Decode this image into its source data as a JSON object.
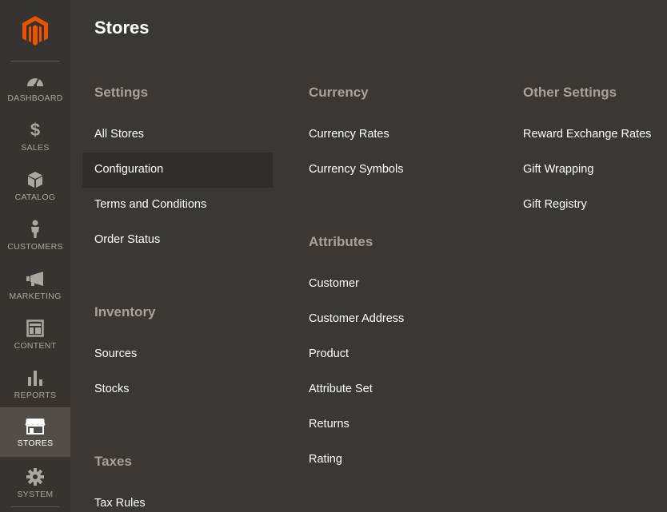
{
  "sidebar": {
    "logo": "magento-logo",
    "items": [
      {
        "label": "DASHBOARD",
        "icon": "gauge-icon"
      },
      {
        "label": "SALES",
        "icon": "dollar-icon"
      },
      {
        "label": "CATALOG",
        "icon": "box-icon"
      },
      {
        "label": "CUSTOMERS",
        "icon": "person-icon"
      },
      {
        "label": "MARKETING",
        "icon": "megaphone-icon"
      },
      {
        "label": "CONTENT",
        "icon": "layout-icon"
      },
      {
        "label": "REPORTS",
        "icon": "bar-chart-icon"
      },
      {
        "label": "STORES",
        "icon": "storefront-icon",
        "active": true
      },
      {
        "label": "SYSTEM",
        "icon": "gear-icon"
      }
    ]
  },
  "page": {
    "title": "Stores"
  },
  "columns": [
    {
      "sections": [
        {
          "heading": "Settings",
          "links": [
            "All Stores",
            "Configuration",
            "Terms and Conditions",
            "Order Status"
          ]
        },
        {
          "heading": "Inventory",
          "links": [
            "Sources",
            "Stocks"
          ]
        },
        {
          "heading": "Taxes",
          "links": [
            "Tax Rules"
          ]
        }
      ]
    },
    {
      "sections": [
        {
          "heading": "Currency",
          "links": [
            "Currency Rates",
            "Currency Symbols"
          ]
        },
        {
          "heading": "Attributes",
          "links": [
            "Customer",
            "Customer Address",
            "Product",
            "Attribute Set",
            "Returns",
            "Rating"
          ]
        }
      ]
    },
    {
      "sections": [
        {
          "heading": "Other Settings",
          "links": [
            "Reward Exchange Rates",
            "Gift Wrapping",
            "Gift Registry"
          ]
        }
      ]
    }
  ],
  "colors": {
    "accent": "#eb5202",
    "background": "#3b3735",
    "sidebar": "#373330",
    "active_item": "#524d49"
  }
}
